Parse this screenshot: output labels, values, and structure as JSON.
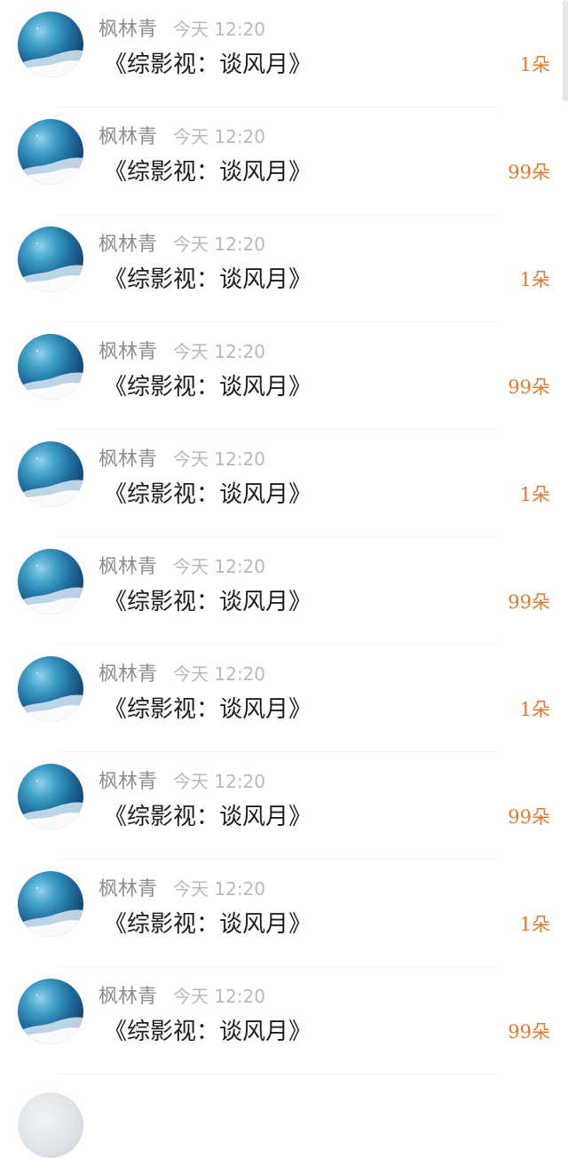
{
  "feed": {
    "items": [
      {
        "name": "枫林青",
        "time": "今天 12:20",
        "title": "《综影视：谈风月》",
        "count": "1朵"
      },
      {
        "name": "枫林青",
        "time": "今天 12:20",
        "title": "《综影视：谈风月》",
        "count": "99朵"
      },
      {
        "name": "枫林青",
        "time": "今天 12:20",
        "title": "《综影视：谈风月》",
        "count": "1朵"
      },
      {
        "name": "枫林青",
        "time": "今天 12:20",
        "title": "《综影视：谈风月》",
        "count": "99朵"
      },
      {
        "name": "枫林青",
        "time": "今天 12:20",
        "title": "《综影视：谈风月》",
        "count": "1朵"
      },
      {
        "name": "枫林青",
        "time": "今天 12:20",
        "title": "《综影视：谈风月》",
        "count": "99朵"
      },
      {
        "name": "枫林青",
        "time": "今天 12:20",
        "title": "《综影视：谈风月》",
        "count": "1朵"
      },
      {
        "name": "枫林青",
        "time": "今天 12:20",
        "title": "《综影视：谈风月》",
        "count": "99朵"
      },
      {
        "name": "枫林青",
        "time": "今天 12:20",
        "title": "《综影视：谈风月》",
        "count": "1朵"
      },
      {
        "name": "枫林青",
        "time": "今天 12:20",
        "title": "《综影视：谈风月》",
        "count": "99朵"
      }
    ],
    "partial_item": {
      "name": "",
      "time": ""
    }
  },
  "colors": {
    "name": "#8e8e8e",
    "time": "#b9b9b9",
    "title": "#1e1e1e",
    "count": "#e07a2f",
    "divider": "#f1f1f1"
  },
  "icons": {
    "avatar": "planet-avatar-icon"
  }
}
